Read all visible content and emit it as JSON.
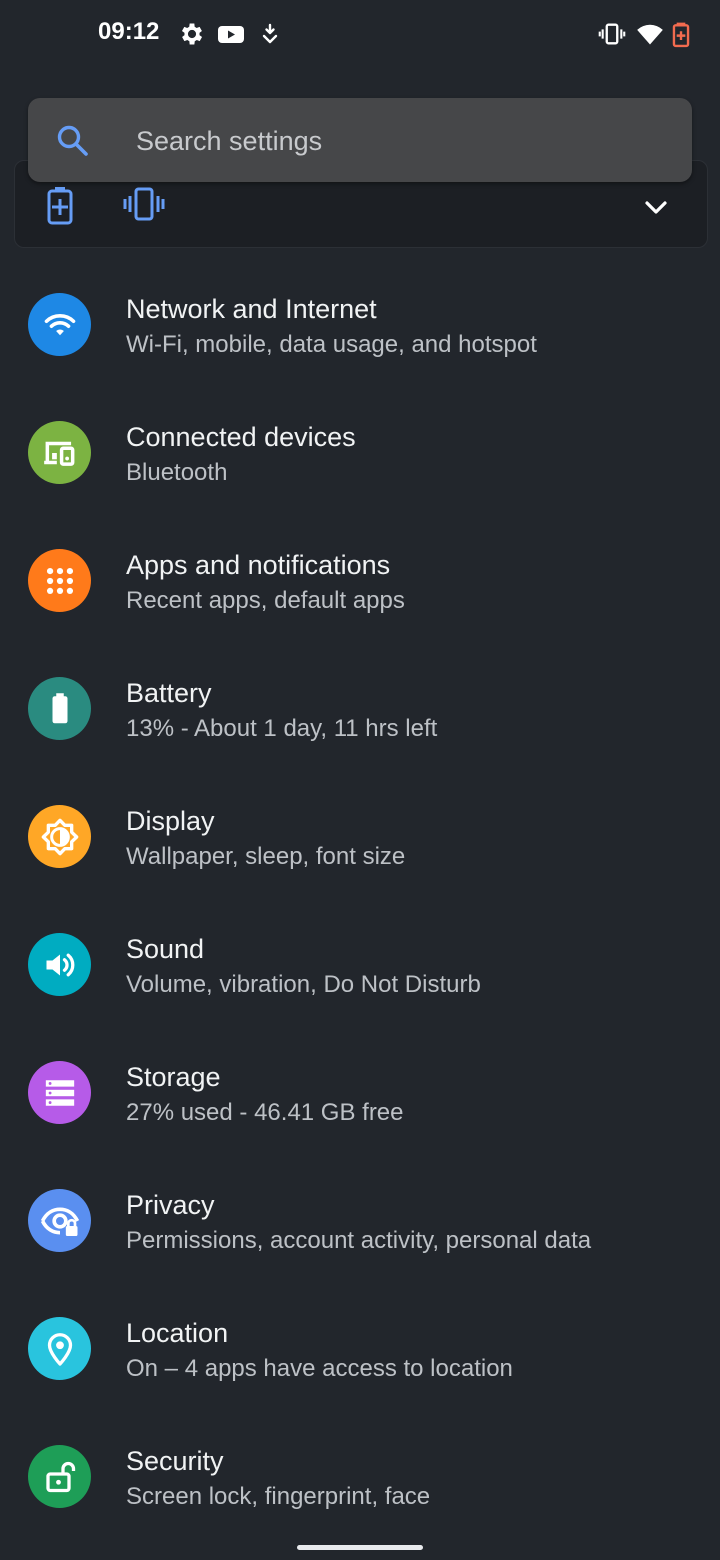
{
  "status_bar": {
    "time": "09:12",
    "left_icons": [
      "gear-icon",
      "youtube-icon",
      "download-icon"
    ],
    "right_icons": [
      "vibrate-icon",
      "wifi-icon",
      "battery-low-icon"
    ],
    "battery_color": "#f26b4f"
  },
  "search": {
    "placeholder": "Search settings"
  },
  "suggestion": {
    "icons": [
      "battery-saver-icon",
      "vibrate-icon"
    ],
    "icon_color": "#669df6"
  },
  "settings": [
    {
      "title": "Network and Internet",
      "subtitle": "Wi-Fi, mobile, data usage, and hotspot",
      "icon": "wifi-icon",
      "color": "#1e88e5"
    },
    {
      "title": "Connected devices",
      "subtitle": "Bluetooth",
      "icon": "devices-icon",
      "color": "#7cb342"
    },
    {
      "title": "Apps and notifications",
      "subtitle": "Recent apps, default apps",
      "icon": "apps-grid-icon",
      "color": "#ff7a1a"
    },
    {
      "title": "Battery",
      "subtitle": "13% - About 1 day, 11 hrs left",
      "icon": "battery-icon",
      "color": "#2a8b80"
    },
    {
      "title": "Display",
      "subtitle": "Wallpaper, sleep, font size",
      "icon": "brightness-icon",
      "color": "#ffa726"
    },
    {
      "title": "Sound",
      "subtitle": "Volume, vibration, Do Not Disturb",
      "icon": "volume-icon",
      "color": "#00acc1"
    },
    {
      "title": "Storage",
      "subtitle": "27% used - 46.41 GB free",
      "icon": "storage-icon",
      "color": "#b65be8"
    },
    {
      "title": "Privacy",
      "subtitle": "Permissions, account activity, personal data",
      "icon": "privacy-eye-icon",
      "color": "#5a8ff0"
    },
    {
      "title": "Location",
      "subtitle": "On – 4 apps have access to location",
      "icon": "location-pin-icon",
      "color": "#29c4de"
    },
    {
      "title": "Security",
      "subtitle": "Screen lock, fingerprint, face",
      "icon": "lock-open-icon",
      "color": "#1e9e57"
    }
  ]
}
